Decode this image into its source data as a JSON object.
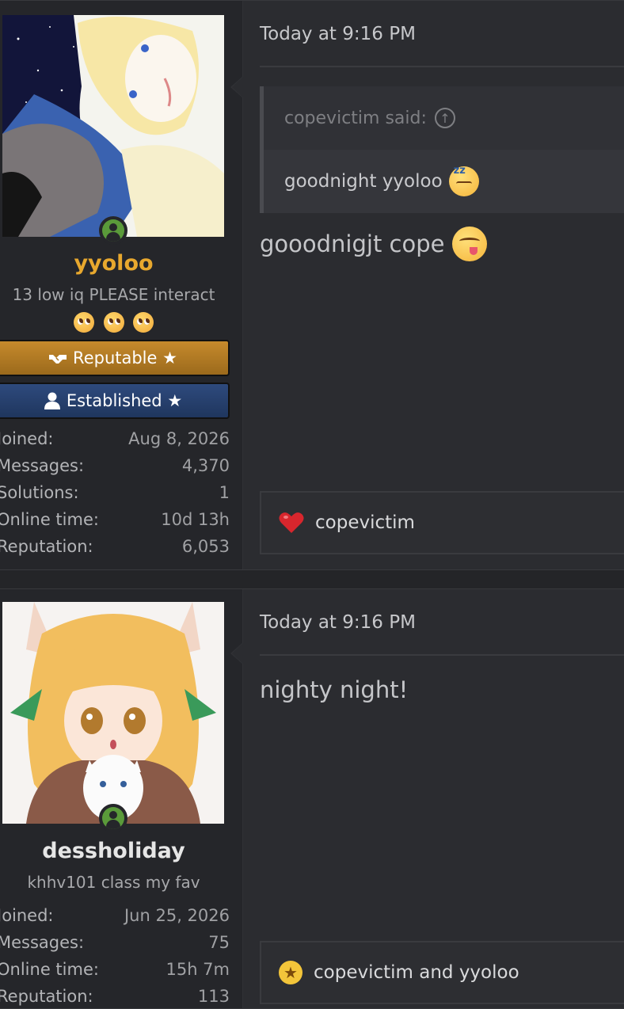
{
  "posts": [
    {
      "user": {
        "name": "yyoloo",
        "name_color": "#e8a82e",
        "title": "13 low iq PLEASE interact",
        "banners": [
          {
            "label": "Reputable ★",
            "icon": "handshake-icon",
            "color": "#b07a26"
          },
          {
            "label": "Established ★",
            "icon": "user-icon",
            "color": "#27406c"
          }
        ],
        "stats": [
          {
            "label": "Joined:",
            "value": "Aug 8, 2026"
          },
          {
            "label": "Messages:",
            "value": "4,370"
          },
          {
            "label": "Solutions:",
            "value": "1"
          },
          {
            "label": "Online time:",
            "value": "10d 13h"
          },
          {
            "label": "Reputation:",
            "value": "6,053"
          }
        ]
      },
      "timestamp": "Today at 9:16 PM",
      "quote": {
        "author": "copevictim said:",
        "text": "goodnight yyoloo"
      },
      "message": "gooodnigjt cope",
      "reactions": {
        "icon": "heart-icon",
        "text": "copevictim"
      }
    },
    {
      "user": {
        "name": "dessholiday",
        "name_color": "#e6e6e6",
        "title": "khhv101 class my fav",
        "stats": [
          {
            "label": "Joined:",
            "value": "Jun 25, 2026"
          },
          {
            "label": "Messages:",
            "value": "75"
          },
          {
            "label": "Online time:",
            "value": "15h 7m"
          },
          {
            "label": "Reputation:",
            "value": "113"
          }
        ]
      },
      "timestamp": "Today at 9:16 PM",
      "message": "nighty night!",
      "reactions": {
        "icon": "star-icon",
        "text": "copevictim and yyoloo"
      }
    }
  ]
}
